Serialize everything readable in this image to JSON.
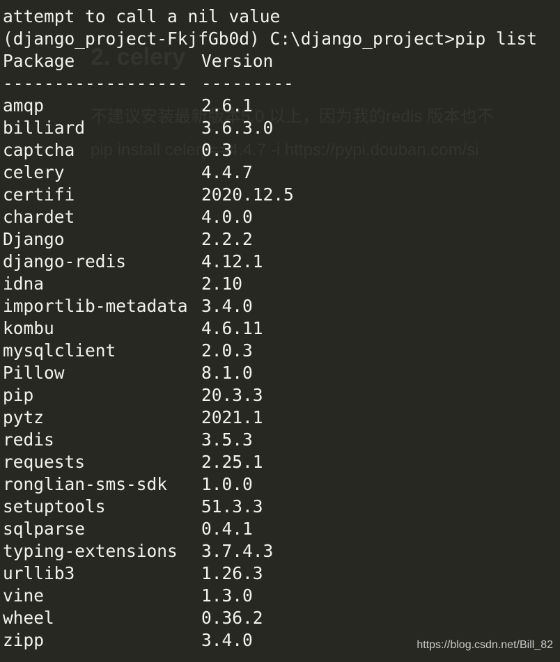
{
  "terminal": {
    "line1": "attempt to call a nil value",
    "prompt": "(django_project-FkjfGb0d) C:\\django_project>pip list",
    "header": {
      "package": "Package",
      "version": "Version"
    },
    "separator": {
      "package": "------------------",
      "version": "---------"
    },
    "packages": [
      {
        "name": "amqp",
        "version": "2.6.1"
      },
      {
        "name": "billiard",
        "version": "3.6.3.0"
      },
      {
        "name": "captcha",
        "version": "0.3"
      },
      {
        "name": "celery",
        "version": "4.4.7"
      },
      {
        "name": "certifi",
        "version": "2020.12.5"
      },
      {
        "name": "chardet",
        "version": "4.0.0"
      },
      {
        "name": "Django",
        "version": "2.2.2"
      },
      {
        "name": "django-redis",
        "version": "4.12.1"
      },
      {
        "name": "idna",
        "version": "2.10"
      },
      {
        "name": "importlib-metadata",
        "version": "3.4.0"
      },
      {
        "name": "kombu",
        "version": "4.6.11"
      },
      {
        "name": "mysqlclient",
        "version": "2.0.3"
      },
      {
        "name": "Pillow",
        "version": "8.1.0"
      },
      {
        "name": "pip",
        "version": "20.3.3"
      },
      {
        "name": "pytz",
        "version": "2021.1"
      },
      {
        "name": "redis",
        "version": "3.5.3"
      },
      {
        "name": "requests",
        "version": "2.25.1"
      },
      {
        "name": "ronglian-sms-sdk",
        "version": "1.0.0"
      },
      {
        "name": "setuptools",
        "version": "51.3.3"
      },
      {
        "name": "sqlparse",
        "version": "0.4.1"
      },
      {
        "name": "typing-extensions",
        "version": "3.7.4.3"
      },
      {
        "name": "urllib3",
        "version": "1.26.3"
      },
      {
        "name": "vine",
        "version": "1.3.0"
      },
      {
        "name": "wheel",
        "version": "0.36.2"
      },
      {
        "name": "zipp",
        "version": "3.4.0"
      }
    ]
  },
  "background_ghost": {
    "heading": "2. celery",
    "line1": "不建议安装最新版本5.0 以上，因为我的redis 版本也不",
    "line2": "pip install celery==4.4.7 -i https://pypi.douban.com/si"
  },
  "watermark": "https://blog.csdn.net/Bill_82",
  "colors": {
    "background": "#272822",
    "foreground": "#f3f3ee"
  }
}
